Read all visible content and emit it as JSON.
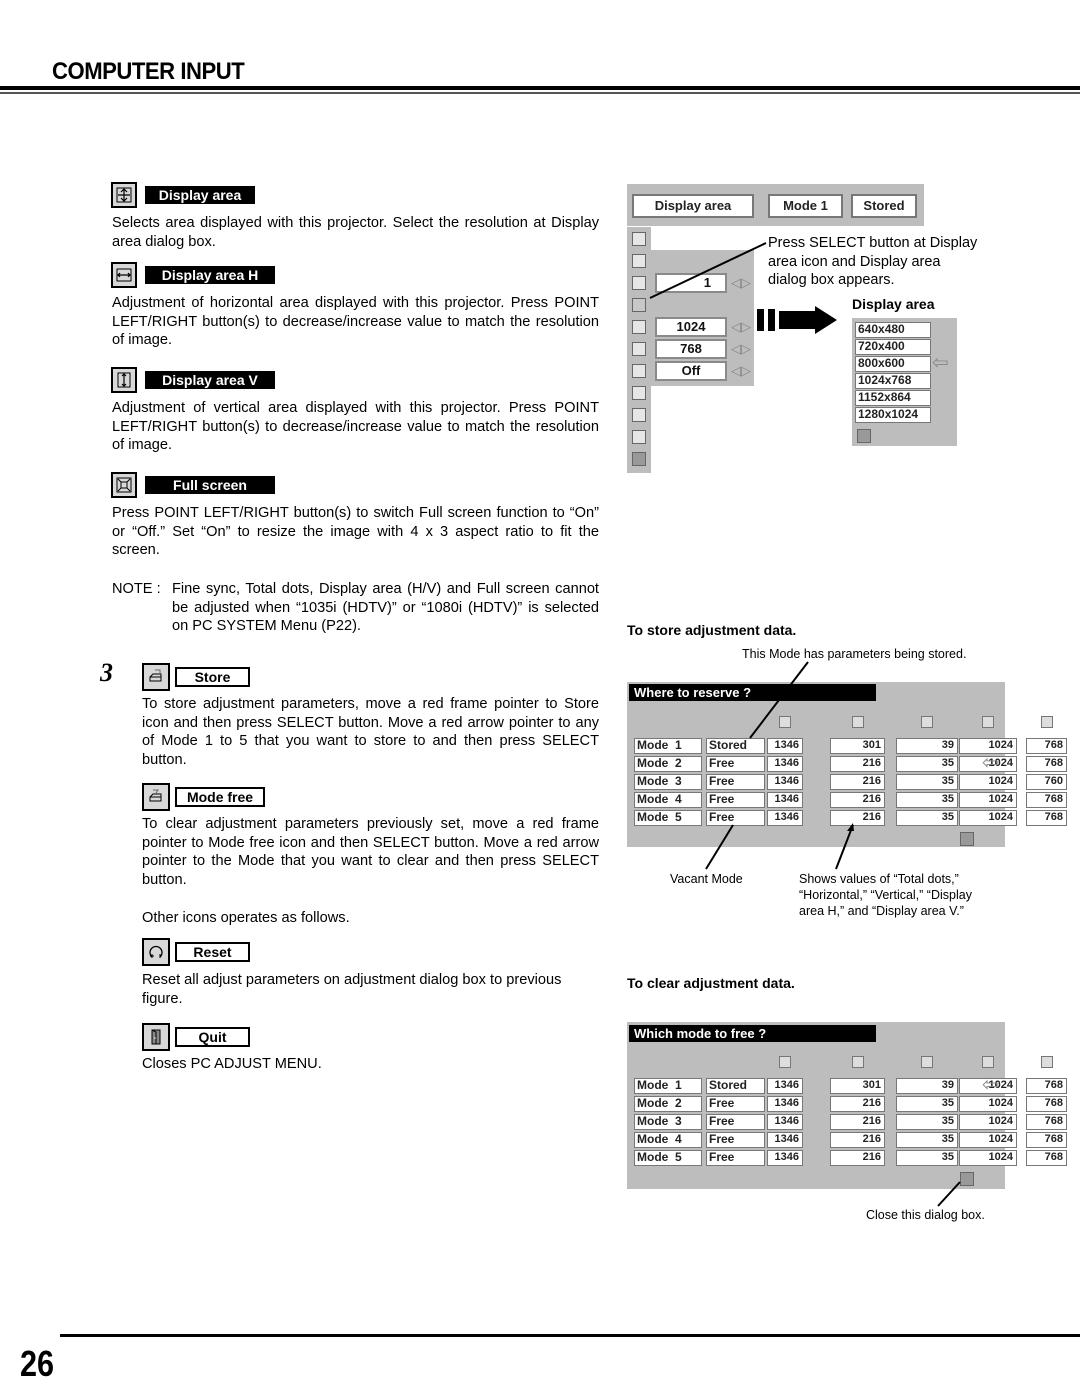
{
  "header": {
    "title": "COMPUTER INPUT"
  },
  "footer": {
    "page_number": "26"
  },
  "left": {
    "sections": [
      {
        "icon": "display-area-icon",
        "label": "Display area",
        "text": "Selects area displayed with this projector.  Select the resolution at Display area dialog box."
      },
      {
        "icon": "display-area-h-icon",
        "label": "Display area H",
        "text": "Adjustment of horizontal area displayed with this projector.  Press POINT LEFT/RIGHT button(s) to decrease/increase value to match the resolution of image."
      },
      {
        "icon": "display-area-v-icon",
        "label": "Display area V",
        "text": "Adjustment of vertical area displayed with this projector.  Press POINT LEFT/RIGHT button(s) to decrease/increase value to match the resolution of image."
      },
      {
        "icon": "full-screen-icon",
        "label": "Full screen",
        "text": "Press POINT LEFT/RIGHT button(s) to switch Full screen function to “On” or “Off.”  Set “On” to resize the image with 4 x 3 aspect ratio to fit the screen."
      }
    ],
    "note_prefix": "NOTE :",
    "note_text": "Fine sync, Total dots, Display area (H/V) and Full screen cannot be adjusted when “1035i (HDTV)” or “1080i (HDTV)” is selected on PC SYSTEM Menu (P22).",
    "step_number": "3",
    "store": {
      "label": "Store",
      "text": "To store adjustment parameters, move a red frame pointer to Store icon and then press SELECT button.  Move a red arrow pointer to any of Mode 1 to 5 that you want to store to and then press SELECT button."
    },
    "mode_free": {
      "label": "Mode free",
      "text": "To clear adjustment parameters previously set, move a red frame pointer to Mode free icon and then SELECT button.  Move a red arrow pointer to the Mode that you want to clear and then press SELECT button."
    },
    "other_icons": "Other icons operates as follows.",
    "reset": {
      "label": "Reset",
      "text": "Reset all adjust parameters on adjustment dialog box to previous figure."
    },
    "quit": {
      "label": "Quit",
      "text": "Closes PC ADJUST MENU."
    }
  },
  "right": {
    "adjust_menu": {
      "top_fields": [
        "Display area",
        "Mode 1",
        "Stored"
      ],
      "values": [
        "1",
        "1024",
        "768",
        "Off"
      ]
    },
    "callout_select": "Press SELECT button at Display area icon and Display area dialog box appears.",
    "display_area_dialog": {
      "title": "Display area",
      "options": [
        "640x480",
        "720x400",
        "800x600",
        "1024x768",
        "1152x864",
        "1280x1024"
      ],
      "selected": "800x600"
    },
    "store_section": {
      "heading": "To store adjustment data.",
      "callout_top": "This Mode has parameters being stored.",
      "dialog_title": "Where to reserve ?",
      "rows": [
        {
          "mode": "Mode  1",
          "status": "Stored",
          "values": [
            "1346",
            "301",
            "39",
            "1024",
            "768"
          ]
        },
        {
          "mode": "Mode  2",
          "status": "Free",
          "values": [
            "1346",
            "216",
            "35",
            "1024",
            "768"
          ]
        },
        {
          "mode": "Mode  3",
          "status": "Free",
          "values": [
            "1346",
            "216",
            "35",
            "1024",
            "760"
          ]
        },
        {
          "mode": "Mode  4",
          "status": "Free",
          "values": [
            "1346",
            "216",
            "35",
            "1024",
            "768"
          ]
        },
        {
          "mode": "Mode  5",
          "status": "Free",
          "values": [
            "1346",
            "216",
            "35",
            "1024",
            "768"
          ]
        }
      ],
      "pointer_row": 1,
      "callout_vacant": "Vacant Mode",
      "callout_values": "Shows values of “Total dots,” “Horizontal,” “Vertical,” “Display area H,” and “Display area V.”"
    },
    "clear_section": {
      "heading": "To clear adjustment data.",
      "dialog_title": "Which mode to free ?",
      "rows": [
        {
          "mode": "Mode  1",
          "status": "Stored",
          "values": [
            "1346",
            "301",
            "39",
            "1024",
            "768"
          ]
        },
        {
          "mode": "Mode  2",
          "status": "Free",
          "values": [
            "1346",
            "216",
            "35",
            "1024",
            "768"
          ]
        },
        {
          "mode": "Mode  3",
          "status": "Free",
          "values": [
            "1346",
            "216",
            "35",
            "1024",
            "768"
          ]
        },
        {
          "mode": "Mode  4",
          "status": "Free",
          "values": [
            "1346",
            "216",
            "35",
            "1024",
            "768"
          ]
        },
        {
          "mode": "Mode  5",
          "status": "Free",
          "values": [
            "1346",
            "216",
            "35",
            "1024",
            "768"
          ]
        }
      ],
      "pointer_row": 0,
      "callout_close": "Close this dialog box."
    }
  }
}
